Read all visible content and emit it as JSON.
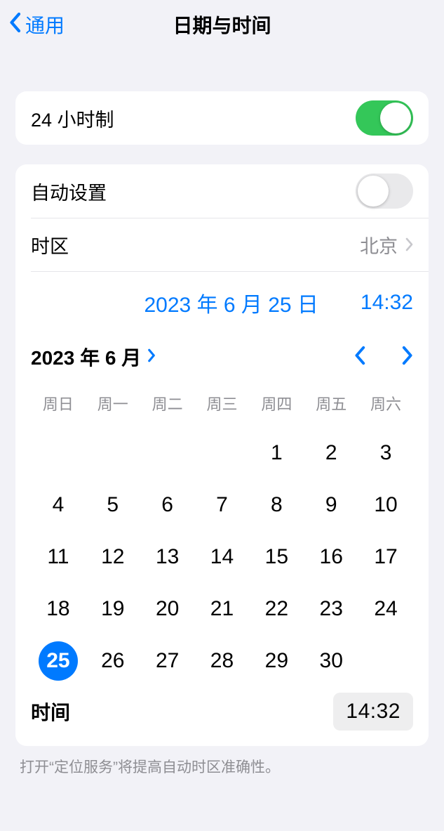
{
  "header": {
    "back_label": "通用",
    "title": "日期与时间"
  },
  "twenty_four_hour": {
    "label": "24 小时制",
    "enabled": true
  },
  "auto_set": {
    "label": "自动设置",
    "enabled": false
  },
  "timezone": {
    "label": "时区",
    "value": "北京"
  },
  "selected": {
    "date_display": "2023 年 6 月 25 日",
    "time_display": "14:32"
  },
  "calendar": {
    "month_label": "2023 年 6 月",
    "weekday_labels": [
      "周日",
      "周一",
      "周二",
      "周三",
      "周四",
      "周五",
      "周六"
    ],
    "leading_blanks": 4,
    "days_in_month": 30,
    "selected_day": 25
  },
  "time_section": {
    "label": "时间",
    "value": "14:32"
  },
  "footer_note": "打开“定位服务”将提高自动时区准确性。"
}
